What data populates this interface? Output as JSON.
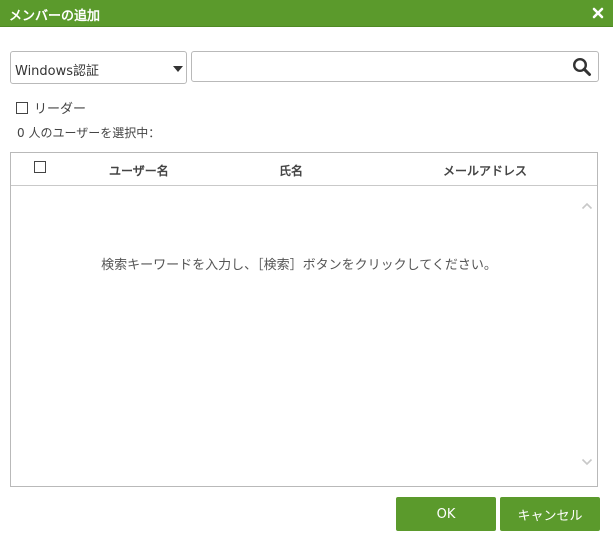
{
  "dialog": {
    "title": "メンバーの追加",
    "close_icon": "close-icon"
  },
  "colors": {
    "accent": "#5b9a2c",
    "border": "#b9b9b9"
  },
  "auth_select": {
    "value": "Windows認証"
  },
  "search": {
    "value": "",
    "placeholder": "",
    "icon": "search-icon"
  },
  "leader": {
    "label": "リーダー",
    "checked": false
  },
  "selected_count": "0 人のユーザーを選択中：",
  "table": {
    "columns": [
      "ユーザー名",
      "氏名",
      "メールアドレス"
    ],
    "empty_message": "検索キーワードを入力し、［検索］ボタンをクリックしてください。"
  },
  "buttons": {
    "ok": "OK",
    "cancel": "キャンセル"
  }
}
